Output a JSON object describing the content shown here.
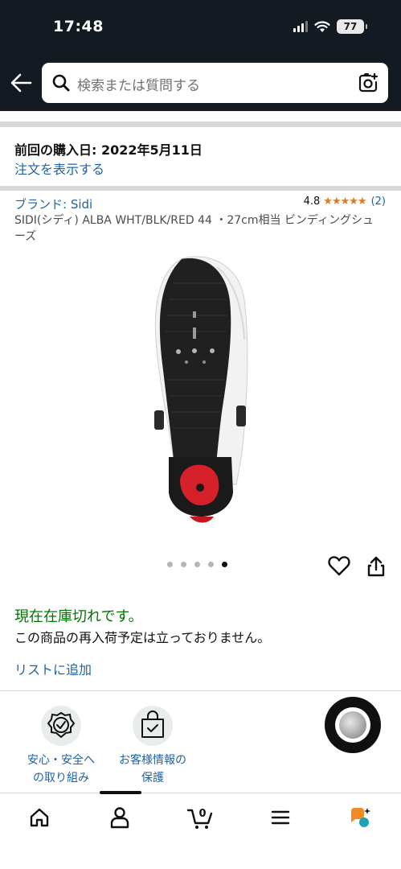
{
  "status_bar": {
    "time": "17:48",
    "battery": "77"
  },
  "search": {
    "placeholder": "検索または質問する"
  },
  "purchase": {
    "title": "前回の購入日: 2022年5月11日",
    "order_link": "注文を表示する"
  },
  "product": {
    "brand": "ブランド: Sidi",
    "rating": "4.8",
    "stars": "★★★★★",
    "rating_count": "(2)",
    "title": "SIDI(シディ) ALBA WHT/BLK/RED 44 ・27cm相当 ビンディングシューズ",
    "image_count": 5,
    "active_image": 5
  },
  "availability": {
    "status": "現在在庫切れです。",
    "message": "この商品の再入荷予定は立っておりません。"
  },
  "actions": {
    "add_to_list": "リストに追加"
  },
  "trust": [
    {
      "label_line1": "安心・安全へ",
      "label_line2": "の取り組み",
      "icon": "shield-check-icon"
    },
    {
      "label_line1": "お客様情報の",
      "label_line2": "保護",
      "icon": "bag-check-icon"
    }
  ],
  "bottom_nav": {
    "items": [
      {
        "icon": "home-icon"
      },
      {
        "icon": "account-icon"
      },
      {
        "icon": "cart-icon",
        "badge": "0"
      },
      {
        "icon": "menu-icon"
      },
      {
        "icon": "rufus-ai-icon"
      }
    ]
  },
  "colors": {
    "header_bg": "#131a22",
    "link": "#2162a1",
    "in_stock_green": "#007600",
    "star": "#de7921"
  }
}
